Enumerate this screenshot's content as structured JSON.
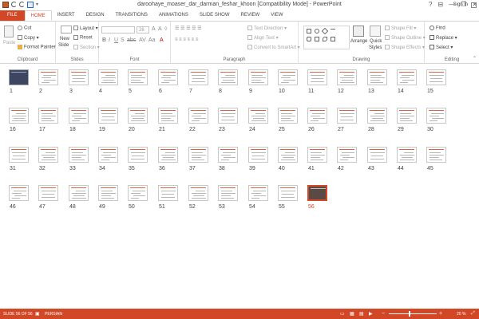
{
  "window": {
    "title": "daroohaye_moaser_dar_darman_feshar_khoon [Compatibility Mode] - PowerPoint",
    "controls": [
      "?",
      "⊟",
      "—",
      "❐",
      "✕"
    ]
  },
  "tabs": [
    {
      "label": "FILE"
    },
    {
      "label": "HOME"
    },
    {
      "label": "INSERT"
    },
    {
      "label": "DESIGN"
    },
    {
      "label": "TRANSITIONS"
    },
    {
      "label": "ANIMATIONS"
    },
    {
      "label": "SLIDE SHOW"
    },
    {
      "label": "REVIEW"
    },
    {
      "label": "VIEW"
    }
  ],
  "signin": "Sign in",
  "ribbon": {
    "clipboard": {
      "label": "Clipboard",
      "paste": "Paste",
      "cut": "Cut",
      "copy": "Copy",
      "format_painter": "Format Painter"
    },
    "slides": {
      "label": "Slides",
      "new_slide": "New",
      "new_slide2": "Slide",
      "layout": "Layout",
      "reset": "Reset",
      "section": "Section"
    },
    "font": {
      "label": "Font",
      "size": "26"
    },
    "paragraph": {
      "label": "Paragraph",
      "text_direction": "Text Direction",
      "align_text": "Align Text",
      "convert": "Convert to SmartArt"
    },
    "drawing": {
      "label": "Drawing",
      "arrange": "Arrange",
      "quick": "Quick",
      "styles": "Styles",
      "shape_fill": "Shape Fill",
      "shape_outline": "Shape Outline",
      "shape_effects": "Shape Effects"
    },
    "editing": {
      "label": "Editing",
      "find": "Find",
      "replace": "Replace",
      "select": "Select"
    }
  },
  "slides": [
    "1",
    "2",
    "3",
    "4",
    "5",
    "6",
    "7",
    "8",
    "9",
    "10",
    "11",
    "12",
    "13",
    "14",
    "15",
    "16",
    "17",
    "18",
    "19",
    "20",
    "21",
    "22",
    "23",
    "24",
    "25",
    "26",
    "27",
    "28",
    "29",
    "30",
    "31",
    "32",
    "33",
    "34",
    "35",
    "36",
    "37",
    "38",
    "39",
    "40",
    "41",
    "42",
    "43",
    "44",
    "45",
    "46",
    "47",
    "48",
    "49",
    "50",
    "51",
    "52",
    "53",
    "54",
    "55",
    "56"
  ],
  "selected_slide": "56",
  "status": {
    "slide_info": "SLIDE 56 OF 56",
    "language": "PERSIAN",
    "zoom": "20 %"
  }
}
